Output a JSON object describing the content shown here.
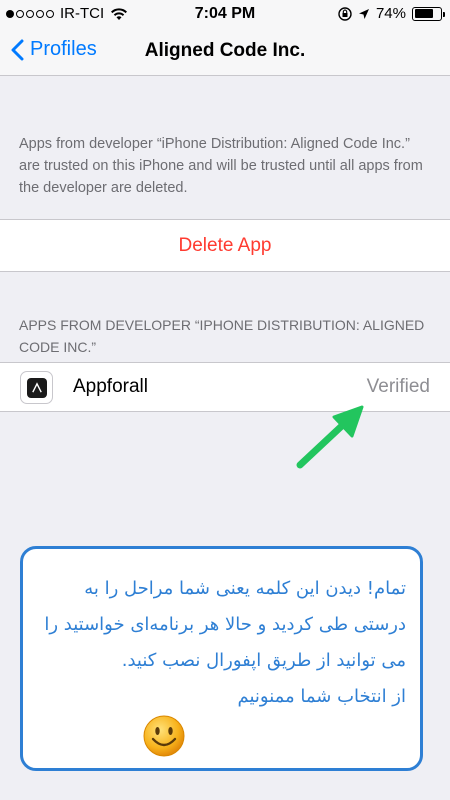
{
  "status_bar": {
    "carrier": "IR-TCI",
    "time": "7:04 PM",
    "battery": "74%",
    "signal_bars_filled": 1,
    "signal_bars_total": 5,
    "icons": [
      "wifi-icon",
      "rotation-lock-icon",
      "location-icon",
      "battery-icon"
    ]
  },
  "nav": {
    "back_label": "Profiles",
    "title": "Aligned Code Inc."
  },
  "trust_text": "Apps from developer “iPhone Distribution: Aligned Code Inc.” are trusted on this iPhone and will be trusted until all apps from the developer are deleted.",
  "delete_label": "Delete App",
  "section_header": "APPS FROM DEVELOPER “IPHONE DISTRIBUTION: ALIGNED CODE INC.”",
  "app": {
    "name": "Appforall",
    "status": "Verified"
  },
  "notice": {
    "text": "تمام! دیدن این کلمه یعنی شما مراحل را به درستی طی کردید و حالا هر برنامه‌ای خواستید را می توانید از طریق اپفورال نصب کنید.",
    "thanks": "از انتخاب شما ممنونیم"
  },
  "colors": {
    "accent": "#007aff",
    "destructive": "#ff3b30",
    "arrow": "#22c55e",
    "notice": "#2e7fd4"
  }
}
